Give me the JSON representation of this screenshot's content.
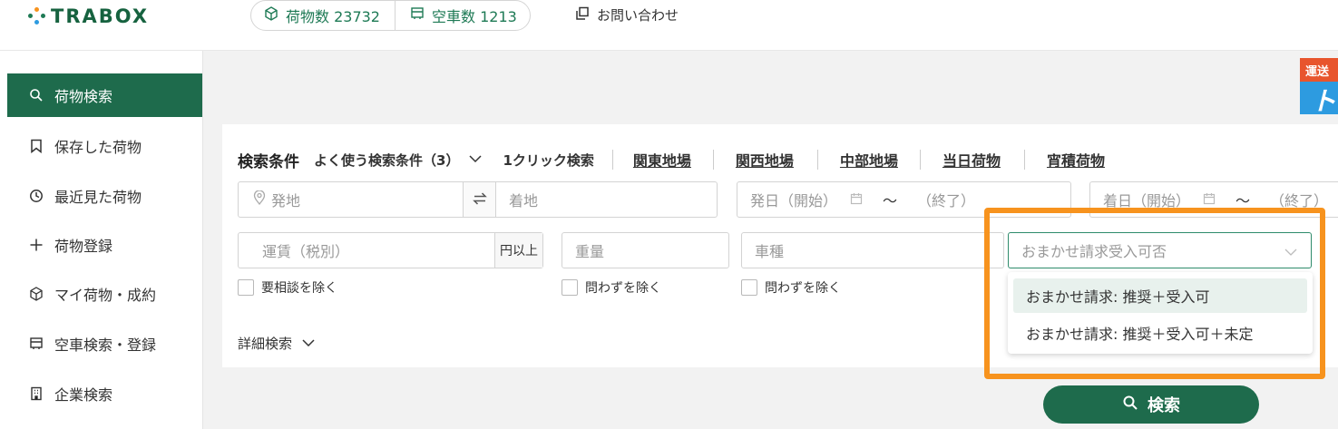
{
  "brand": {
    "name": "TRABOX",
    "colors": {
      "primary": "#1e6b4c",
      "highlight": "#f7931e",
      "dot_orange": "#f7931e",
      "dot_green": "#1e7a55",
      "dot_blue": "#2d9be0"
    }
  },
  "header": {
    "cargo_count_label": "荷物数 23732",
    "truck_count_label": "空車数 1213",
    "contact_label": "お問い合わせ"
  },
  "sidebar": {
    "items": [
      {
        "label": "荷物検索",
        "icon": "search-icon",
        "active": true
      },
      {
        "label": "保存した荷物",
        "icon": "bookmark-icon",
        "active": false
      },
      {
        "label": "最近見た荷物",
        "icon": "clock-icon",
        "active": false
      },
      {
        "label": "荷物登録",
        "icon": "plus-icon",
        "active": false
      },
      {
        "label": "マイ荷物・成約",
        "icon": "box-icon",
        "active": false
      },
      {
        "label": "空車検索・登録",
        "icon": "truck-icon",
        "active": false
      },
      {
        "label": "企業検索",
        "icon": "building-icon",
        "active": false
      }
    ]
  },
  "banner": {
    "top_text": "運送",
    "glyph": "ト"
  },
  "search": {
    "title": "検索条件",
    "saved_conditions_label": "よく使う検索条件（3）",
    "one_click_label": "1クリック検索",
    "quick_links": [
      "関東地場",
      "関西地場",
      "中部地場",
      "当日荷物",
      "宵積荷物"
    ],
    "origin_placeholder": "発地",
    "swap_icon": "swap-icon",
    "destination_placeholder": "着地",
    "departure_start_placeholder": "発日（開始）",
    "departure_tilde": "〜",
    "departure_end_placeholder": "（終了）",
    "arrival_start_placeholder": "着日（開始）",
    "arrival_tilde": "〜",
    "arrival_end_placeholder": "（終了）",
    "fare_placeholder": "運賃（税別）",
    "fare_suffix": "円以上",
    "weight_placeholder": "重量",
    "vehicle_type_placeholder": "車種",
    "omakase_placeholder": "おまかせ請求受入可否",
    "checkbox_negotiable": "要相談を除く",
    "checkbox_weight_any": "問わずを除く",
    "checkbox_vehicle_any": "問わずを除く",
    "detail_search_label": "詳細検索",
    "search_button_label": "検索"
  },
  "omakase_options": [
    "おまかせ請求: 推奨＋受入可",
    "おまかせ請求: 推奨＋受入可＋未定"
  ]
}
